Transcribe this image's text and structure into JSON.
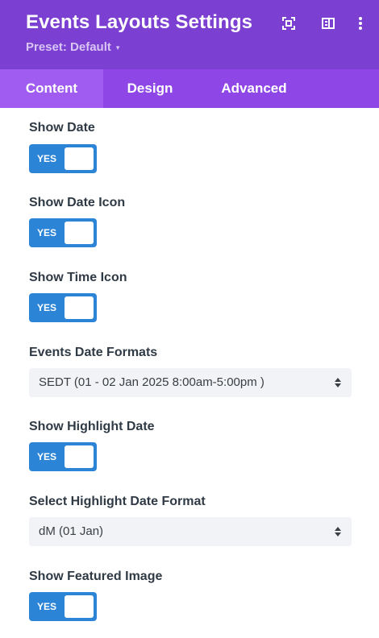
{
  "header": {
    "title": "Events Layouts Settings",
    "preset_label": "Preset: Default",
    "icons": [
      "focus-icon",
      "sidebar-layout-icon",
      "more-options-icon"
    ]
  },
  "tabs": [
    {
      "label": "Content",
      "active": true
    },
    {
      "label": "Design",
      "active": false
    },
    {
      "label": "Advanced",
      "active": false
    }
  ],
  "fields": {
    "show_date": {
      "label": "Show Date",
      "toggle": "YES"
    },
    "show_date_icon": {
      "label": "Show Date Icon",
      "toggle": "YES"
    },
    "show_time_icon": {
      "label": "Show Time Icon",
      "toggle": "YES"
    },
    "events_date_formats": {
      "label": "Events Date Formats",
      "value": "SEDT (01 - 02 Jan 2025 8:00am-5:00pm )"
    },
    "show_highlight_date": {
      "label": "Show Highlight Date",
      "toggle": "YES"
    },
    "select_highlight_date_format": {
      "label": "Select Highlight Date Format",
      "value": "dM (01 Jan)"
    },
    "show_featured_image": {
      "label": "Show Featured Image",
      "toggle": "YES"
    }
  },
  "colors": {
    "header_bg": "#7b3fd1",
    "tabs_bg": "#8e46e6",
    "active_tab_bg": "#a05cf0",
    "toggle_on": "#2c84d6",
    "select_bg": "#f1f3f6"
  }
}
